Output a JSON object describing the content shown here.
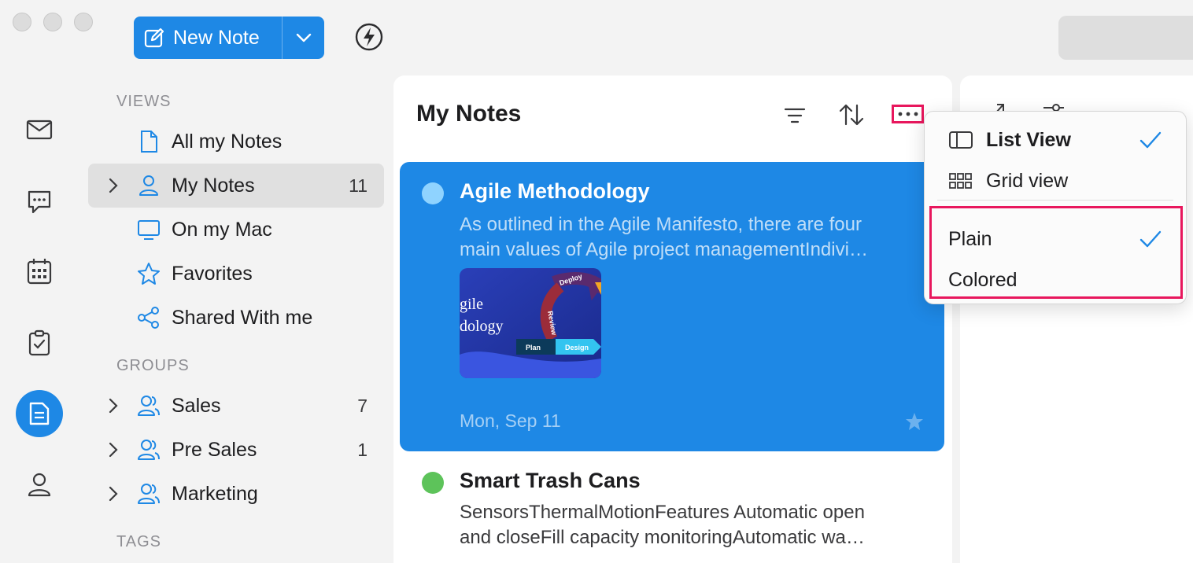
{
  "toolbar": {
    "new_note_label": "New Note"
  },
  "sidebar": {
    "views_title": "VIEWS",
    "views": [
      {
        "label": "All my Notes",
        "count": ""
      },
      {
        "label": "My Notes",
        "count": "11"
      },
      {
        "label": "On my Mac",
        "count": ""
      },
      {
        "label": "Favorites",
        "count": ""
      },
      {
        "label": "Shared With me",
        "count": ""
      }
    ],
    "groups_title": "GROUPS",
    "groups": [
      {
        "label": "Sales",
        "count": "7"
      },
      {
        "label": "Pre Sales",
        "count": "1"
      },
      {
        "label": "Marketing",
        "count": ""
      }
    ],
    "tags_title": "TAGS"
  },
  "notes": {
    "title": "My Notes",
    "items": [
      {
        "title": "Agile Methodology",
        "snippet_line1": "As outlined in the Agile Manifesto, there are four",
        "snippet_line2": "main values of Agile project managementIndivi…",
        "date": "Mon, Sep 11",
        "dot_color": "#8fd3ff",
        "thumbnail": {
          "text_line1": "gile",
          "text_line2": "dology",
          "labels": [
            "Deploy",
            "Review",
            "Plan",
            "Design"
          ]
        }
      },
      {
        "title": "Smart Trash Cans",
        "snippet_line1": "SensorsThermalMotionFeatures Automatic open",
        "snippet_line2": "and closeFill capacity monitoringAutomatic wa…",
        "dot_color": "#5dc35a"
      }
    ]
  },
  "view_menu": {
    "items": [
      {
        "label": "List View",
        "checked": true,
        "icon": "list-view-icon"
      },
      {
        "label": "Grid view",
        "checked": false,
        "icon": "grid-view-icon"
      },
      {
        "label": "Plain",
        "checked": true
      },
      {
        "label": "Colored",
        "checked": false
      }
    ]
  },
  "colors": {
    "accent": "#1e88e5",
    "highlight": "#e8175d"
  }
}
